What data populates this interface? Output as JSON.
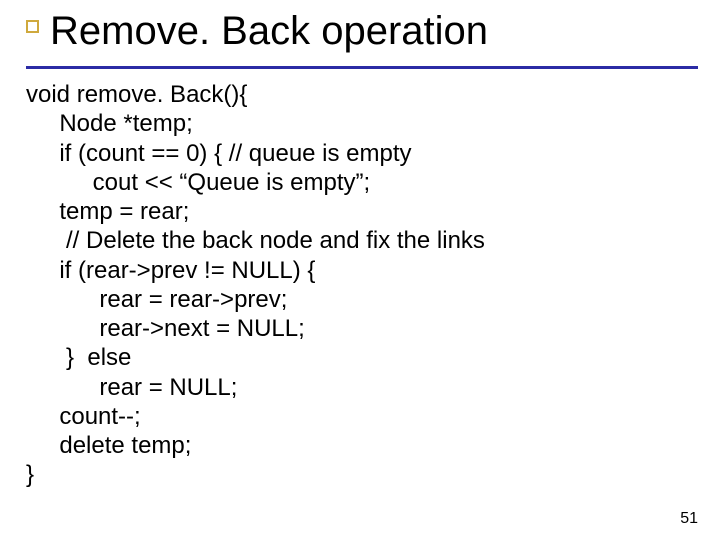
{
  "title": "Remove. Back operation",
  "code": {
    "l1": "void remove. Back(){",
    "l2": "     Node *temp;",
    "l3": "     if (count == 0) { // queue is empty",
    "l4": "          cout << “Queue is empty”;",
    "l5": "     temp = rear;",
    "l6": "      // Delete the back node and fix the links",
    "l7": "     if (rear->prev != NULL) {",
    "l8": "           rear = rear->prev;",
    "l9": "           rear->next = NULL;",
    "l10": "      }  else",
    "l11": "           rear = NULL;",
    "l12": "     count--;",
    "l13": "     delete temp;",
    "l14": "}"
  },
  "page_number": "51"
}
